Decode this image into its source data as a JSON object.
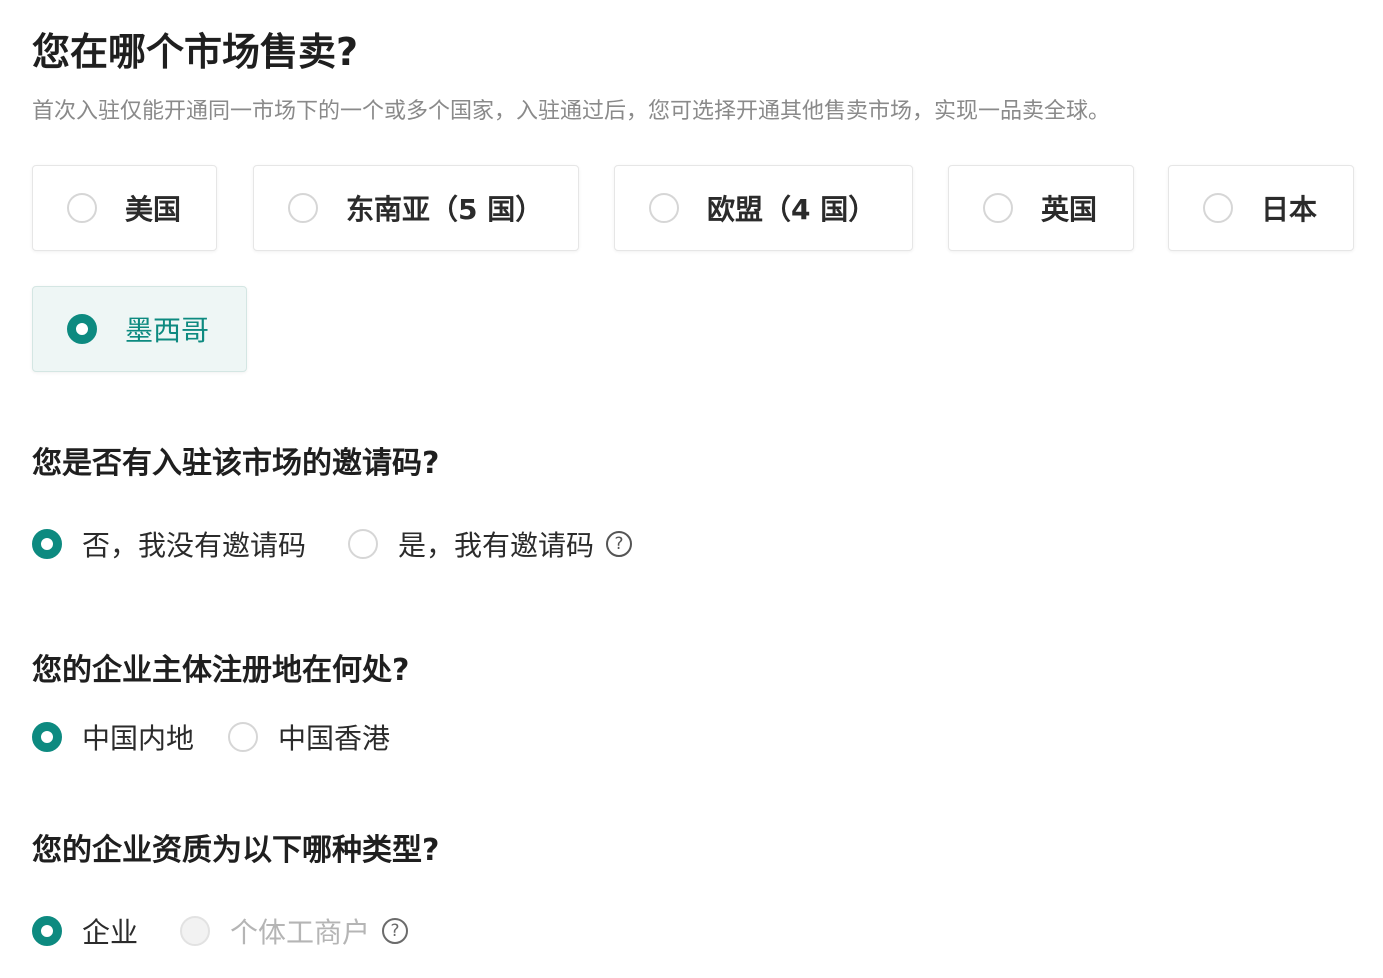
{
  "market_section": {
    "title": "您在哪个市场售卖?",
    "subtitle": "首次入驻仅能开通同一市场下的一个或多个国家，入驻通过后，您可选择开通其他售卖市场，实现一品卖全球。",
    "options": [
      {
        "label": "美国",
        "selected": false
      },
      {
        "label": "东南亚（5 国）",
        "selected": false
      },
      {
        "label": "欧盟（4 国）",
        "selected": false
      },
      {
        "label": "英国",
        "selected": false
      },
      {
        "label": "日本",
        "selected": false
      },
      {
        "label": "墨西哥",
        "selected": true
      }
    ]
  },
  "invite_section": {
    "title": "您是否有入驻该市场的邀请码?",
    "options": [
      {
        "label": "否，我没有邀请码",
        "selected": true
      },
      {
        "label": "是，我有邀请码",
        "selected": false,
        "help_icon": "question-circle-icon"
      }
    ]
  },
  "registration_section": {
    "title": "您的企业主体注册地在何处?",
    "options": [
      {
        "label": "中国内地",
        "selected": true
      },
      {
        "label": "中国香港",
        "selected": false
      }
    ]
  },
  "qualification_section": {
    "title": "您的企业资质为以下哪种类型?",
    "options": [
      {
        "label": "企业",
        "selected": true
      },
      {
        "label": "个体工商户",
        "selected": false,
        "disabled": true,
        "help_icon": "question-circle-icon"
      }
    ]
  },
  "colors": {
    "accent": "#0d8a80",
    "selected_card_bg": "#eef6f5",
    "subtitle_text": "#8a8a8a",
    "disabled_text": "#b5b5b5"
  },
  "icons": {
    "help": "?"
  }
}
